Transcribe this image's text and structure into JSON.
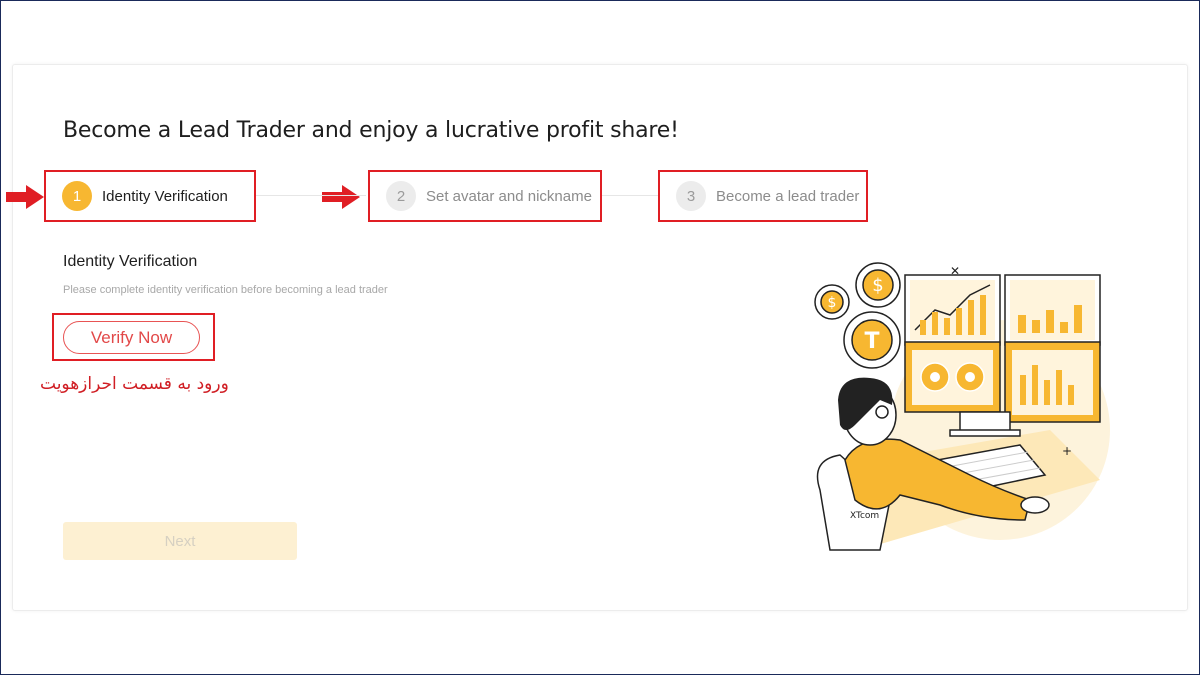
{
  "page": {
    "title": "Become a Lead Trader and enjoy a lucrative profit share!"
  },
  "steps": [
    {
      "number": "1",
      "label": "Identity Verification",
      "state": "active"
    },
    {
      "number": "2",
      "label": "Set avatar and nickname",
      "state": "inactive"
    },
    {
      "number": "3",
      "label": "Become a lead trader",
      "state": "inactive"
    }
  ],
  "section": {
    "title": "Identity Verification",
    "description": "Please complete identity verification before becoming a lead trader",
    "verify_label": "Verify Now",
    "annotation": "ورود به قسمت احرازهویت"
  },
  "next_label": "Next",
  "illustration": {
    "brand": "XTcom"
  },
  "colors": {
    "accent": "#f7b731",
    "highlight": "#e01e24",
    "verify": "#e24848",
    "next_disabled_bg": "#fdf0d2"
  }
}
